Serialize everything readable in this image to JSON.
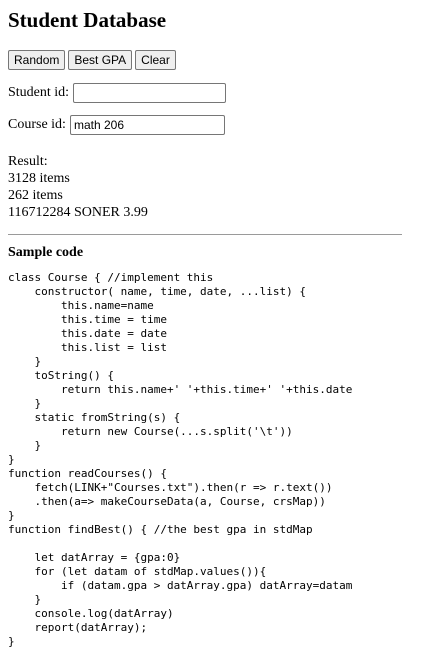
{
  "header": {
    "title": "Student Database"
  },
  "toolbar": {
    "random_label": "Random",
    "best_gpa_label": "Best GPA",
    "clear_label": "Clear"
  },
  "form": {
    "student_id_label": "Student id:",
    "student_id_value": "",
    "course_id_label": "Course id:",
    "course_id_value": "math 206"
  },
  "result": {
    "label": "Result:",
    "lines": [
      "3128 items",
      "262 items",
      "116712284 SONER 3.99"
    ]
  },
  "sample": {
    "heading": "Sample code",
    "code": "class Course { //implement this\n    constructor( name, time, date, ...list) {\n        this.name=name\n        this.time = time\n        this.date = date\n        this.list = list\n    }\n    toString() {\n        return this.name+' '+this.time+' '+this.date\n    }\n    static fromString(s) {\n        return new Course(...s.split('\\t'))\n    }\n}\nfunction readCourses() {\n    fetch(LINK+\"Courses.txt\").then(r => r.text())\n    .then(a=> makeCourseData(a, Course, crsMap))\n}\nfunction findBest() { //the best gpa in stdMap\n\n    let datArray = {gpa:0}\n    for (let datam of stdMap.values()){\n        if (datam.gpa > datArray.gpa) datArray=datam\n    }\n    console.log(datArray)\n    report(datArray);\n}"
  }
}
